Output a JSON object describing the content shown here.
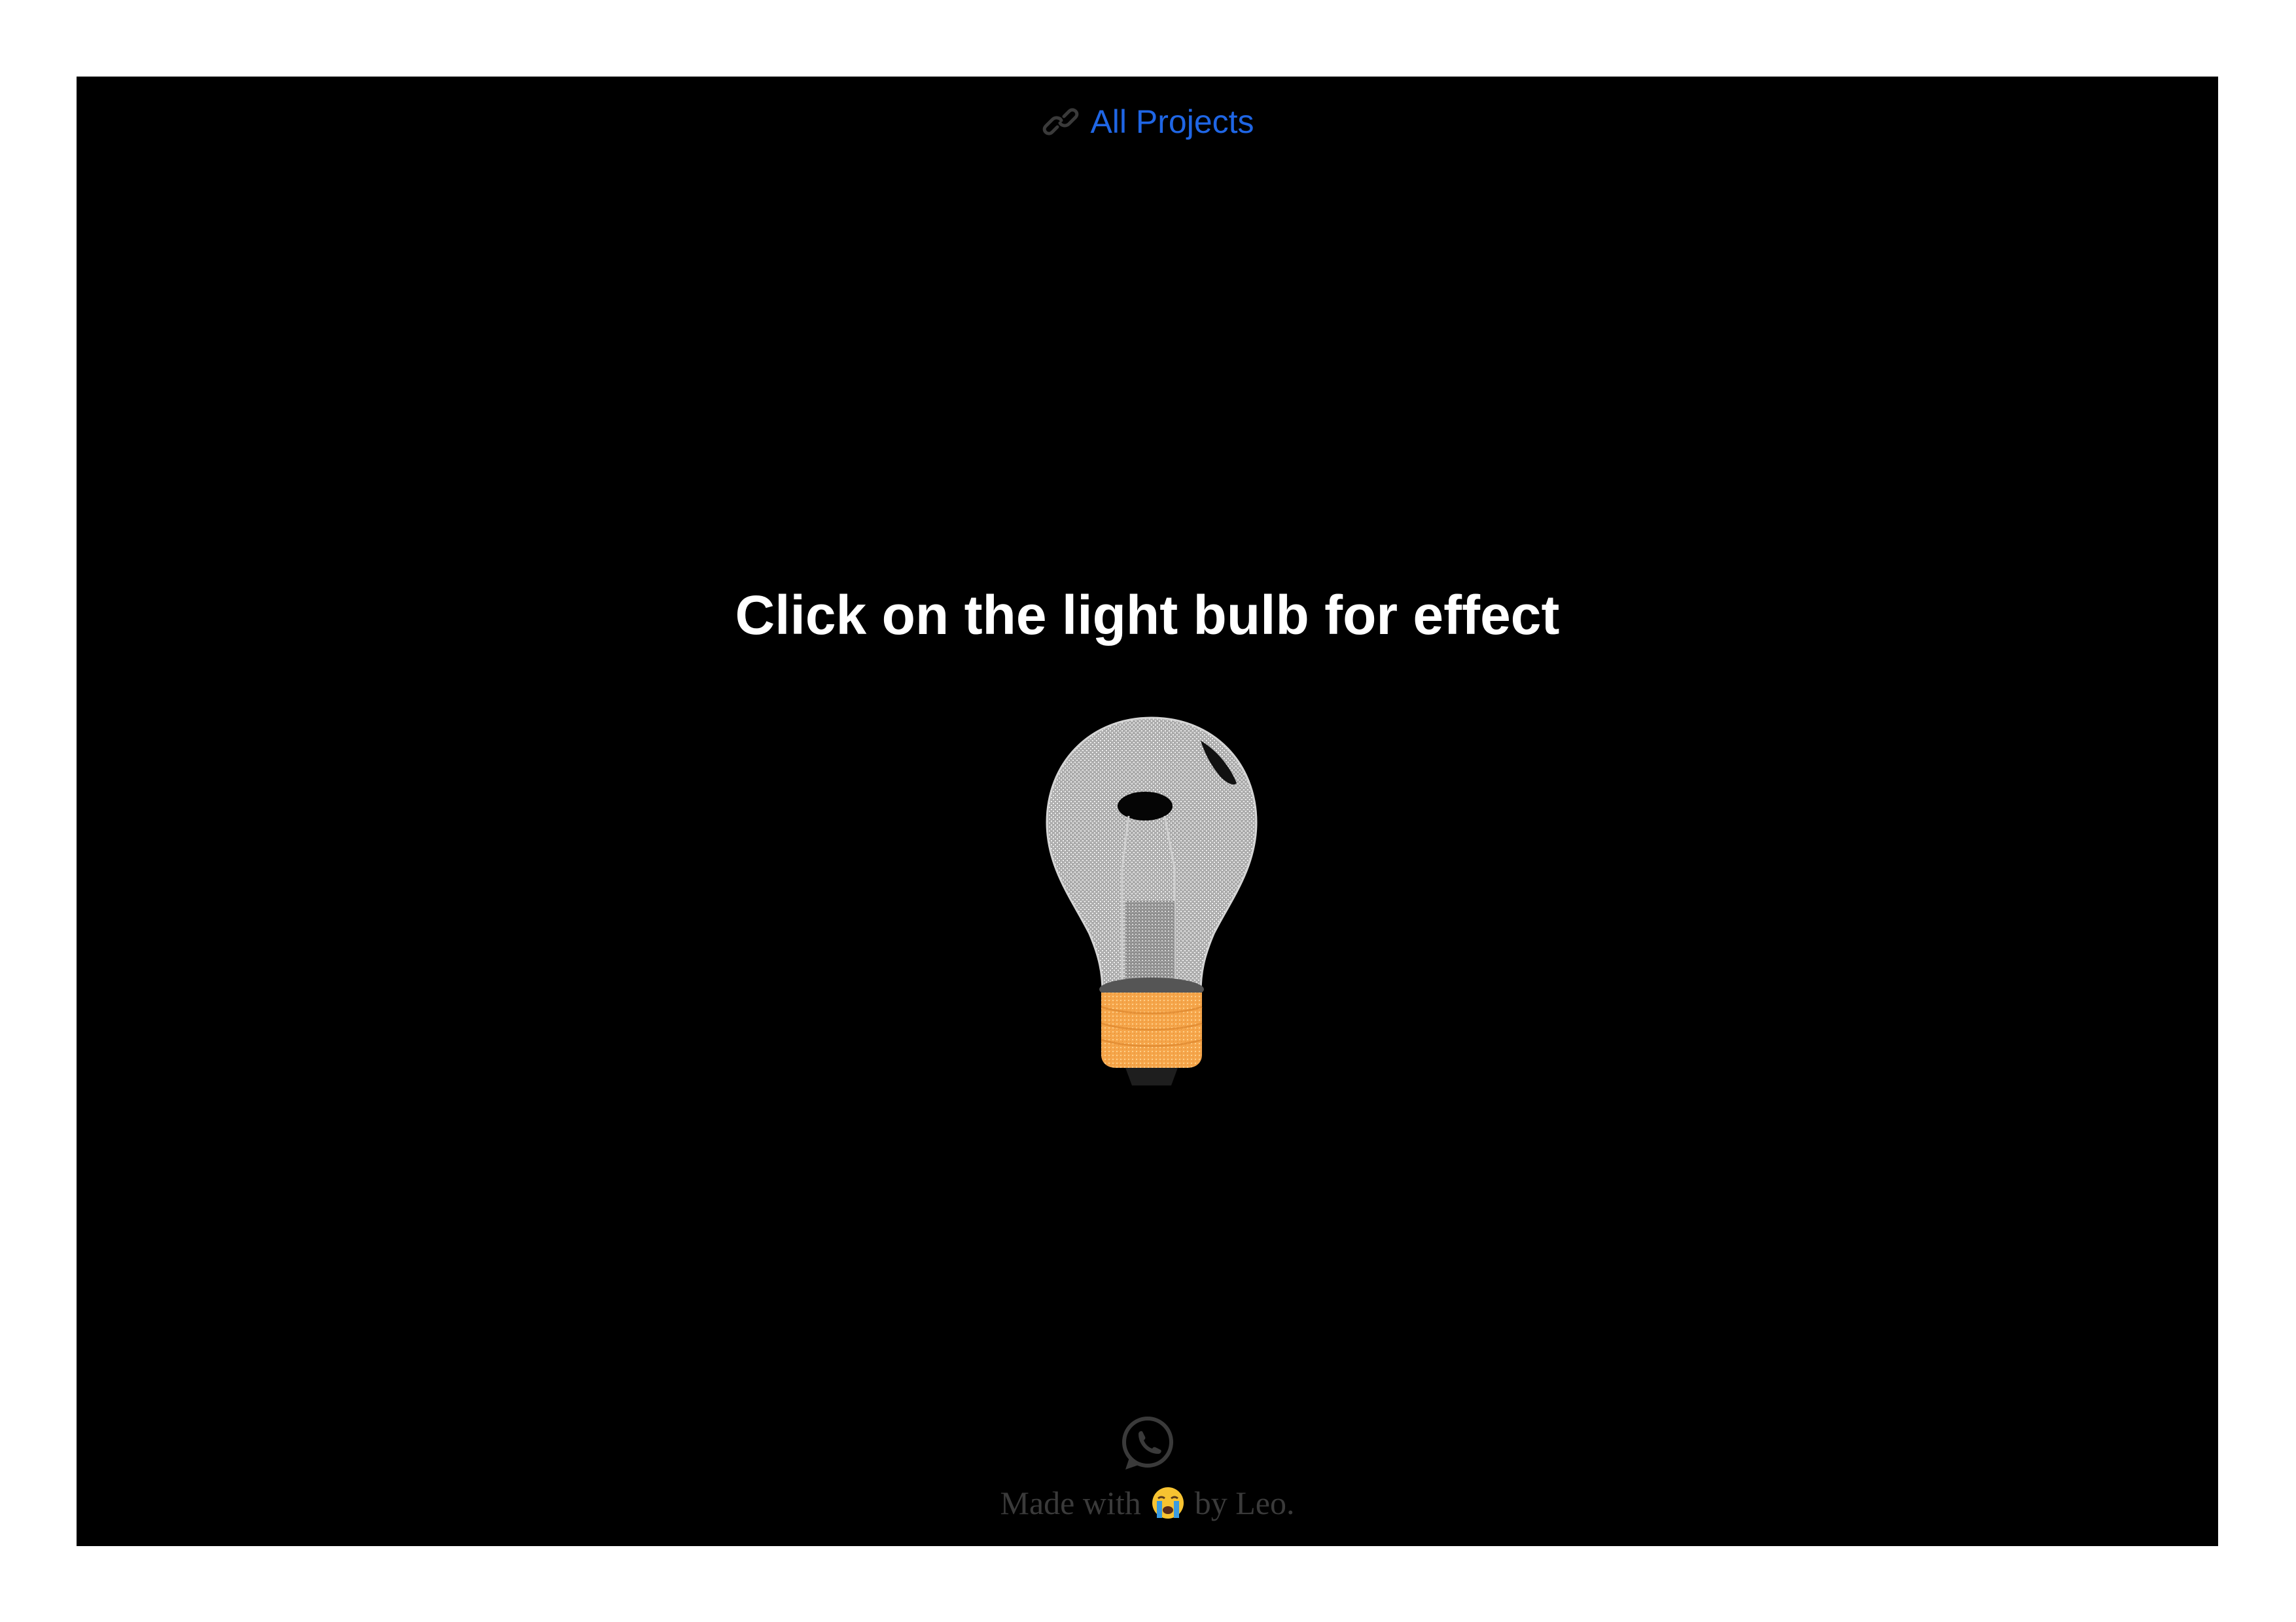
{
  "nav": {
    "link_label": "All Projects",
    "link_icon": "link-chain-icon",
    "link_color": "#1f66e5"
  },
  "main": {
    "headline": "Click on the light bulb for effect",
    "bulb_icon": "light-bulb-icon",
    "bulb_state": "off",
    "base_color": "#f5a54a"
  },
  "footer": {
    "social_icon": "whatsapp-icon",
    "made_with": "Made with",
    "emoji": "crying-face-emoji",
    "by": "by Leo."
  },
  "colors": {
    "background": "#000000",
    "text": "#ffffff",
    "footer_text": "#3a3a3a"
  }
}
